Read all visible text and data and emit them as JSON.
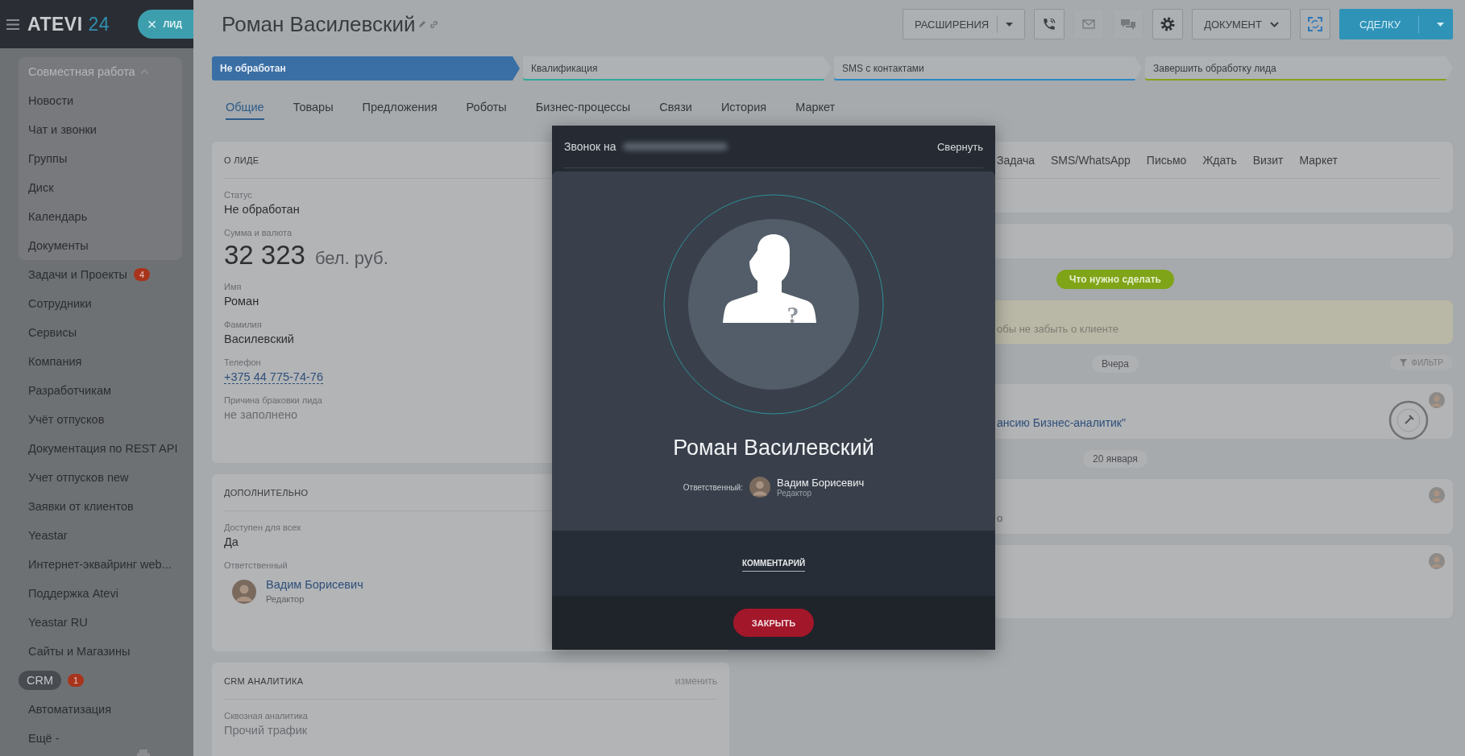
{
  "sidebar": {
    "logo": {
      "name": "ATEVI",
      "number": "24"
    },
    "entity_chip": {
      "close": "×",
      "label": "ЛИД"
    },
    "group": {
      "title": "Совместная работа",
      "expanded": true,
      "items": [
        {
          "label": "Новости",
          "selected": false
        },
        {
          "label": "Чат и звонки",
          "selected": false
        },
        {
          "label": "Группы",
          "selected": false
        },
        {
          "label": "Диск",
          "selected": false
        },
        {
          "label": "Календарь",
          "selected": false
        },
        {
          "label": "Документы",
          "selected": false
        }
      ]
    },
    "items": [
      {
        "label": "Задачи и Проекты",
        "counter": "4",
        "selected": false
      },
      {
        "label": "Сотрудники",
        "selected": false
      },
      {
        "label": "Сервисы",
        "selected": false
      },
      {
        "label": "Компания",
        "selected": false
      },
      {
        "label": "Разработчикам",
        "selected": false
      },
      {
        "label": "Учёт отпусков",
        "selected": false
      },
      {
        "label": "Документация по REST API",
        "selected": false
      },
      {
        "label": "Учет отпусков new",
        "selected": false
      },
      {
        "label": "Заявки от клиентов",
        "selected": false
      },
      {
        "label": "Yeastar",
        "selected": false
      },
      {
        "label": "Интернет-эквайринг web...",
        "selected": false
      },
      {
        "label": "Поддержка Atevi",
        "selected": false
      },
      {
        "label": "Yeastar RU",
        "selected": false
      },
      {
        "label": "Сайты и Магазины",
        "selected": false
      },
      {
        "label": "CRM",
        "counter": "1",
        "selected": true
      },
      {
        "label": "Автоматизация",
        "selected": false
      },
      {
        "label": "Ещё -",
        "selected": false
      }
    ]
  },
  "header": {
    "title": "Роман Василевский",
    "buttons": [
      {
        "kind": "split",
        "label": "РАСШИРЕНИЯ",
        "disabled": false
      },
      {
        "kind": "phone",
        "disabled": false
      },
      {
        "kind": "mail",
        "disabled": true
      },
      {
        "kind": "chat",
        "disabled": true
      },
      {
        "kind": "gear",
        "disabled": false
      },
      {
        "kind": "dropdown",
        "label": "ДОКУМЕНТ",
        "disabled": false
      },
      {
        "kind": "scan",
        "disabled": false
      },
      {
        "kind": "primary-split",
        "label": "СДЕЛКУ",
        "disabled": false
      }
    ]
  },
  "stages": [
    {
      "label": "Не обработан",
      "selected": true,
      "color": "#3a6fa5"
    },
    {
      "label": "Квалификация",
      "selected": false,
      "color": "#2fa89a"
    },
    {
      "label": "SMS с контактами",
      "selected": false,
      "color": "#2b86c4"
    },
    {
      "label": "Завершить обработку лида",
      "selected": false,
      "color": "#86a019"
    }
  ],
  "tabs": [
    {
      "label": "Общие",
      "selected": true
    },
    {
      "label": "Товары",
      "selected": false
    },
    {
      "label": "Предложения",
      "selected": false
    },
    {
      "label": "Роботы",
      "selected": false
    },
    {
      "label": "Бизнес-процессы",
      "selected": false
    },
    {
      "label": "Связи",
      "selected": false
    },
    {
      "label": "История",
      "selected": false
    },
    {
      "label": "Маркет",
      "selected": false
    }
  ],
  "lead_card": {
    "title": "О ЛИДЕ",
    "fields": [
      {
        "kind": "text",
        "label": "Статус",
        "value": "Не обработан"
      },
      {
        "kind": "money",
        "label": "Сумма и валюта",
        "value": "32 323",
        "currency": "бел. руб."
      },
      {
        "kind": "text",
        "label": "Имя",
        "value": "Роман"
      },
      {
        "kind": "text",
        "label": "Фамилия",
        "value": "Василевский"
      },
      {
        "kind": "phone",
        "label": "Телефон",
        "value": "+375 44 775-74-76"
      },
      {
        "kind": "empty",
        "label": "Причина браковки лида",
        "value": "не заполнено"
      }
    ]
  },
  "extra_card": {
    "title": "ДОПОЛНИТЕЛЬНО",
    "fields": [
      {
        "kind": "text",
        "label": "Доступен для всех",
        "value": "Да"
      },
      {
        "kind": "user",
        "label": "Ответственный",
        "name": "Вадим Борисевич",
        "role": "Редактор"
      }
    ]
  },
  "analytics_card": {
    "title": "CRM АНАЛИТИКА",
    "action": "изменить",
    "fields": [
      {
        "kind": "empty",
        "label": "Сквозная аналитика",
        "value": "Прочий трафик"
      }
    ]
  },
  "activity": {
    "tabs": [
      "Задача",
      "SMS/WhatsApp",
      "Письмо",
      "Ждать",
      "Визит",
      "Маркет"
    ],
    "todo_badge": "Что нужно сделать",
    "note": "обы не забыть о клиенте",
    "filter": "ФИЛЬТР",
    "feed": [
      {
        "kind": "date",
        "label": "Вчера"
      },
      {
        "kind": "item",
        "link": "ансию Бизнес-аналитик\"",
        "pinned": true
      },
      {
        "kind": "date",
        "label": "20 января"
      },
      {
        "kind": "item",
        "text": "о",
        "pinned": false
      },
      {
        "kind": "item",
        "pinned": false
      }
    ]
  },
  "call": {
    "title": "Звонок на",
    "minimize": "Свернуть",
    "caller": "Роман Василевский",
    "avatar_mark": "?",
    "responsible_label": "Ответственный:",
    "responsible": {
      "name": "Вадим Борисевич",
      "role": "Редактор"
    },
    "tabs": [
      {
        "label": "КОММЕНТАРИЙ",
        "selected": true
      }
    ],
    "close": "ЗАКРЫТЬ"
  }
}
